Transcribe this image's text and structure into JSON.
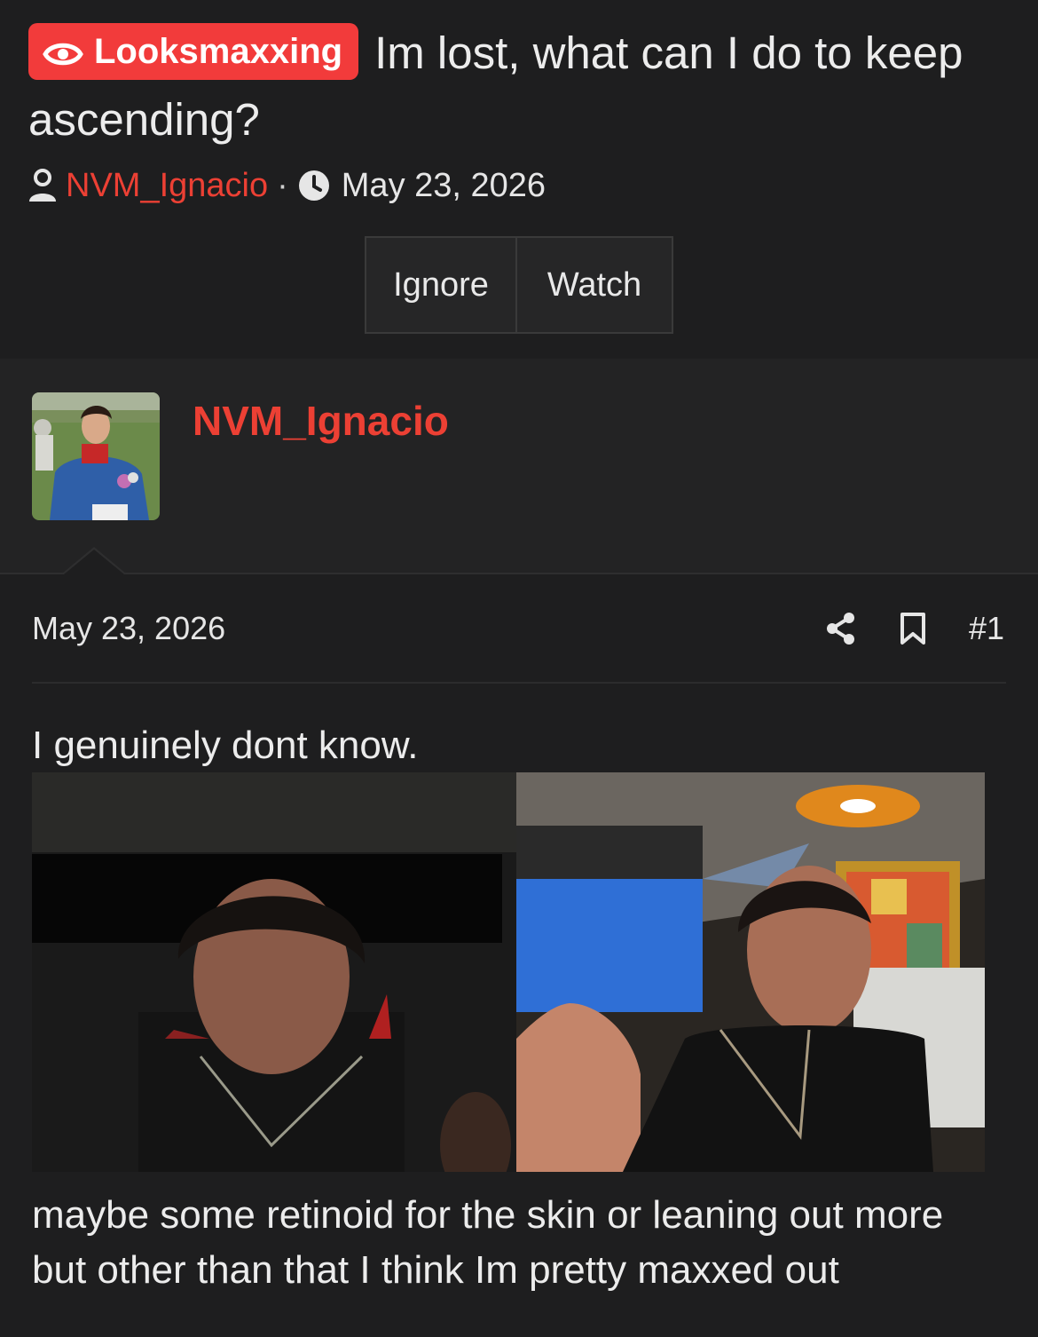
{
  "thread": {
    "forum_badge": "Looksmaxxing",
    "title": "Im lost, what can I do to keep ascending?",
    "author": "NVM_Ignacio",
    "separator": "·",
    "date": "May 23, 2026"
  },
  "actions": {
    "ignore_label": "Ignore",
    "watch_label": "Watch"
  },
  "post": {
    "username": "NVM_Ignacio",
    "date": "May 23, 2026",
    "post_number": "#1",
    "text_before_images": "I genuinely dont know.",
    "text_after_images": "maybe some retinoid for the skin or leaning out more but other than that I think Im pretty maxxed out",
    "icons": [
      "eye-icon",
      "user-icon",
      "clock-icon",
      "share-icon",
      "bookmark-icon"
    ]
  },
  "colors": {
    "background": "#1e1e1f",
    "badge": "#f23b3b",
    "username": "#ec4034",
    "text": "#ececec"
  }
}
